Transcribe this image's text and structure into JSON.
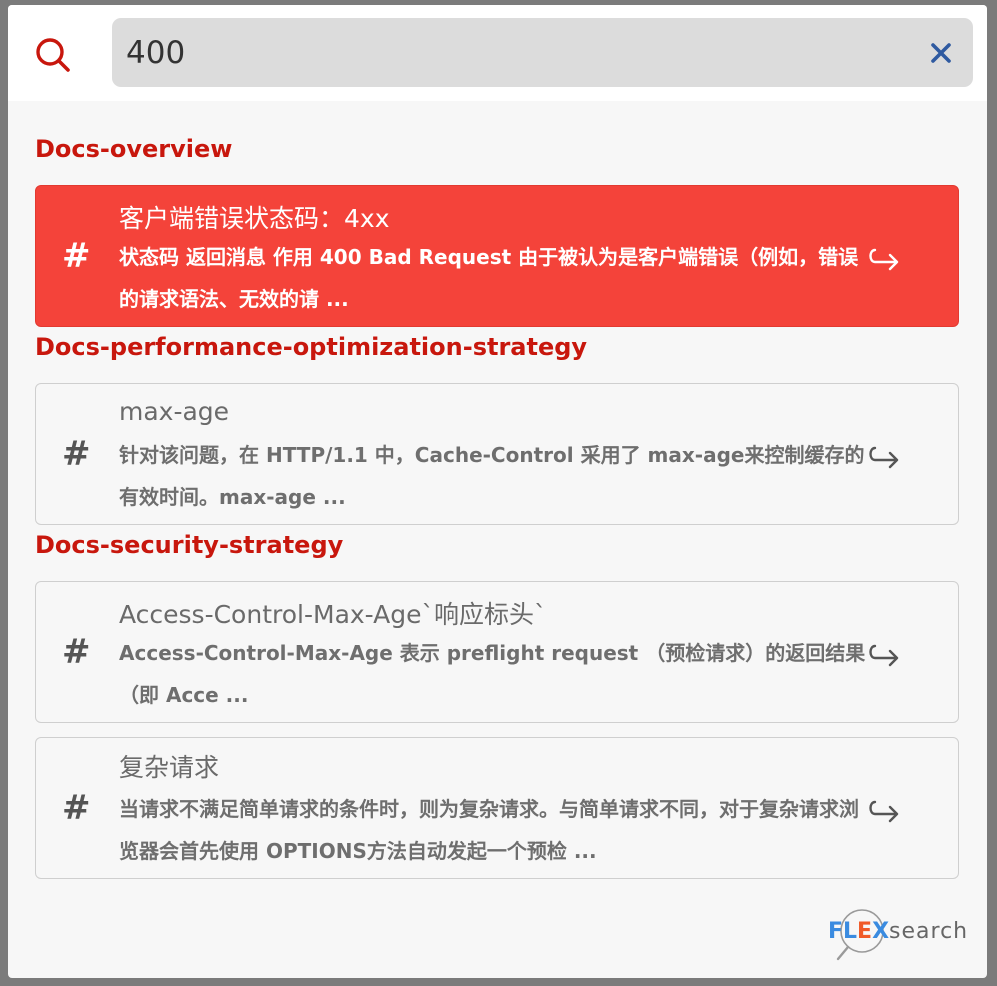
{
  "search": {
    "value": "400",
    "placeholder": ""
  },
  "icons": {
    "search": "search-icon",
    "clear": "close-icon",
    "hash": "hash-icon",
    "enter": "enter-return-icon"
  },
  "colors": {
    "accent": "#c8170d",
    "active_bg": "#f4433a",
    "clear_icon": "#2f5aa0"
  },
  "groups": [
    {
      "title": "Docs-overview",
      "results": [
        {
          "title": "客户端错误状态码：4xx",
          "snippet": "状态码 返回消息 作用 400 Bad Request 由于被认为是客户端错误（例如，错误的请求语法、无效的请 ...",
          "active": true
        }
      ]
    },
    {
      "title": "Docs-performance-optimization-strategy",
      "results": [
        {
          "title": "max-age",
          "snippet": "针对该问题，在 HTTP/1.1 中，Cache-Control 采用了 max-age来控制缓存的有效时间。max-age ...",
          "active": false
        }
      ]
    },
    {
      "title": "Docs-security-strategy",
      "results": [
        {
          "title": "Access-Control-Max-Age`响应标头`",
          "snippet": "Access-Control-Max-Age 表示 preflight request （预检请求）的返回结果（即 Acce ...",
          "active": false
        },
        {
          "title": "复杂请求",
          "snippet": "当请求不满足简单请求的条件时，则为复杂请求。与简单请求不同，对于复杂请求浏览器会首先使用 OPTIONS方法自动发起一个预检 ...",
          "active": false
        }
      ]
    }
  ],
  "brand": {
    "part1": "FL",
    "part2": "E",
    "part3": "X",
    "part4": "search"
  }
}
